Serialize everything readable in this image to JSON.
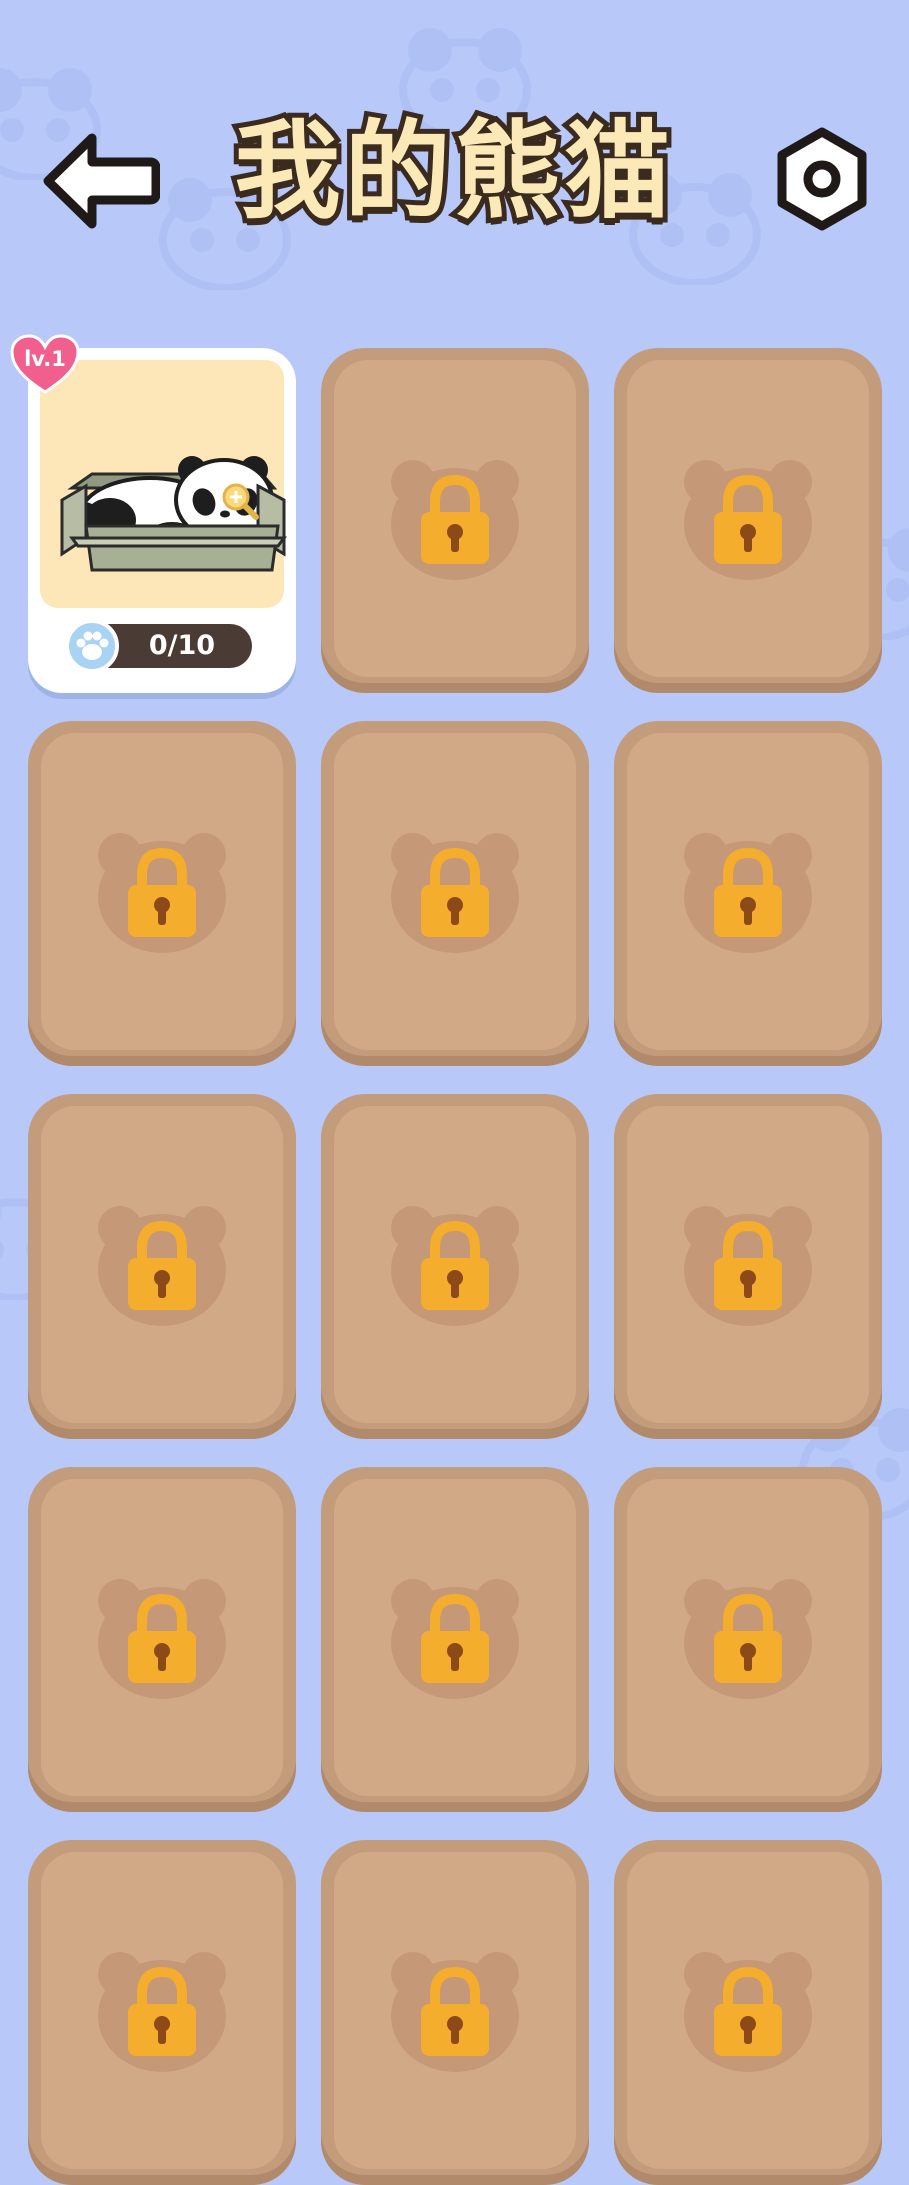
{
  "header": {
    "title": "我的熊猫",
    "back_icon": "arrow-left-icon",
    "settings_icon": "gear-icon"
  },
  "colors": {
    "background": "#b7c8f9",
    "locked_card": "#c39d7b",
    "locked_card_inner": "#d2a987",
    "lock": "#f4ad2c",
    "title_fill": "#fce9b8",
    "title_stroke": "#3b2a1e"
  },
  "panda_cards": [
    {
      "state": "unlocked",
      "level": "lv.1",
      "progress": "0/10",
      "icons": [
        "heart-icon",
        "panda-in-box-illustration",
        "zoom-icon",
        "paw-icon"
      ]
    },
    {
      "state": "locked",
      "icon": "lock-icon"
    },
    {
      "state": "locked",
      "icon": "lock-icon"
    },
    {
      "state": "locked",
      "icon": "lock-icon"
    },
    {
      "state": "locked",
      "icon": "lock-icon"
    },
    {
      "state": "locked",
      "icon": "lock-icon"
    },
    {
      "state": "locked",
      "icon": "lock-icon"
    },
    {
      "state": "locked",
      "icon": "lock-icon"
    },
    {
      "state": "locked",
      "icon": "lock-icon"
    },
    {
      "state": "locked",
      "icon": "lock-icon"
    },
    {
      "state": "locked",
      "icon": "lock-icon"
    },
    {
      "state": "locked",
      "icon": "lock-icon"
    },
    {
      "state": "locked",
      "icon": "lock-icon"
    },
    {
      "state": "locked",
      "icon": "lock-icon"
    },
    {
      "state": "locked",
      "icon": "lock-icon"
    }
  ]
}
